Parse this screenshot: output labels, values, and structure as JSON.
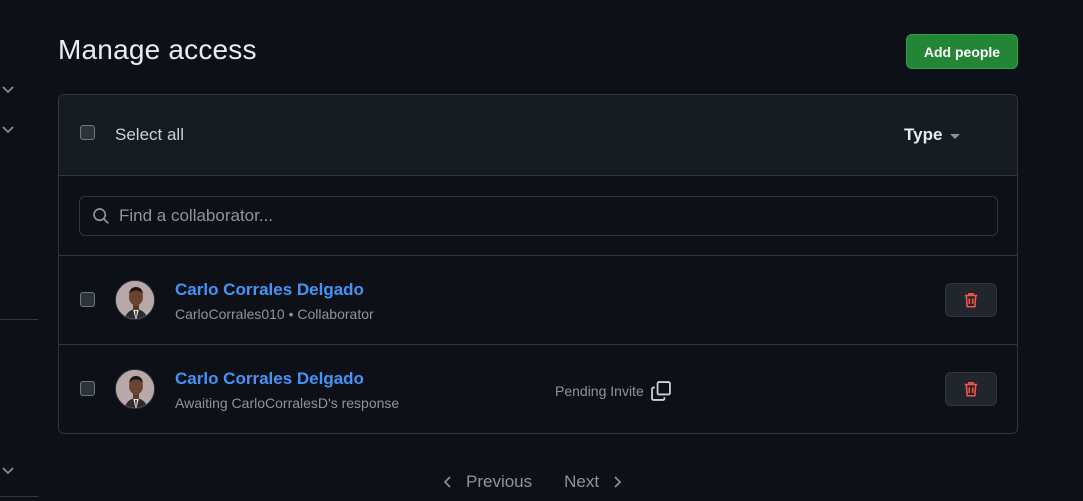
{
  "page": {
    "title": "Manage access",
    "add_button_label": "Add people"
  },
  "header": {
    "select_all_label": "Select all",
    "type_filter_label": "Type"
  },
  "search": {
    "placeholder": "Find a collaborator...",
    "value": ""
  },
  "collaborators": [
    {
      "name": "Carlo Corrales Delgado",
      "subtitle": "CarloCorrales010 • Collaborator",
      "status": "",
      "checked": false
    },
    {
      "name": "Carlo Corrales Delgado",
      "subtitle": "Awaiting CarloCorralesD's response",
      "status": "Pending Invite",
      "checked": false
    }
  ],
  "pagination": {
    "previous_label": "Previous",
    "next_label": "Next"
  },
  "colors": {
    "background": "#0d1117",
    "panel": "#161b22",
    "border": "#30363d",
    "primary_button": "#238636",
    "link": "#4493f8",
    "danger": "#f85149",
    "muted_text": "#8b949e"
  },
  "icons": {
    "sidebar": [
      "chevron-down-icon",
      "chevron-down-icon",
      "chevron-down-icon"
    ],
    "search": "search-icon",
    "copy": "copy-icon",
    "delete": "trash-icon",
    "prev": "chevron-left-icon",
    "next": "chevron-right-icon",
    "type_caret": "caret-down-icon"
  }
}
